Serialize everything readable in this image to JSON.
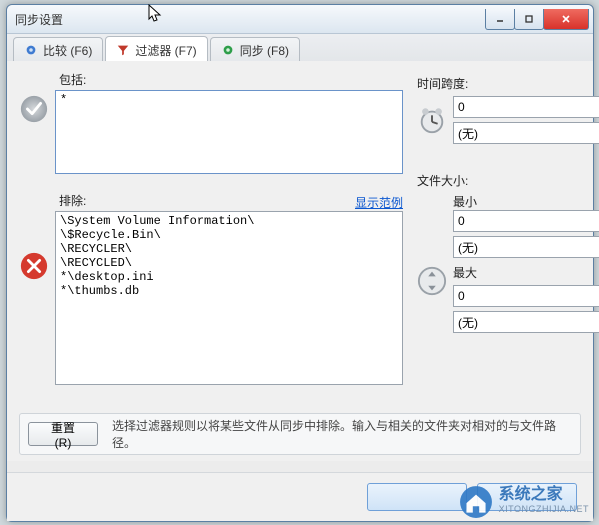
{
  "window": {
    "title": "同步设置"
  },
  "tabs": {
    "compare": "比较 (F6)",
    "filter": "过滤器 (F7)",
    "sync": "同步 (F8)"
  },
  "include": {
    "label": "包括:",
    "value": "*"
  },
  "exclude": {
    "label": "排除:",
    "example_link": "显示范例",
    "value": "\\System Volume Information\\\n\\$Recycle.Bin\\\n\\RECYCLER\\\n\\RECYCLED\\\n*\\desktop.ini\n*\\thumbs.db"
  },
  "timespan": {
    "label": "时间跨度:",
    "value": "0",
    "unit": "(无)"
  },
  "filesize": {
    "label": "文件大小:",
    "min_label": "最小",
    "min_value": "0",
    "min_unit": "(无)",
    "max_label": "最大",
    "max_value": "0",
    "max_unit": "(无)"
  },
  "buttons": {
    "reset": "重置(R)"
  },
  "hint": "选择过滤器规则以将某些文件从同步中排除。输入与相关的文件夹对相对的与文件路径。",
  "watermark": {
    "cn": "系统之家",
    "en": "XITONGZHIJIA.NET"
  }
}
